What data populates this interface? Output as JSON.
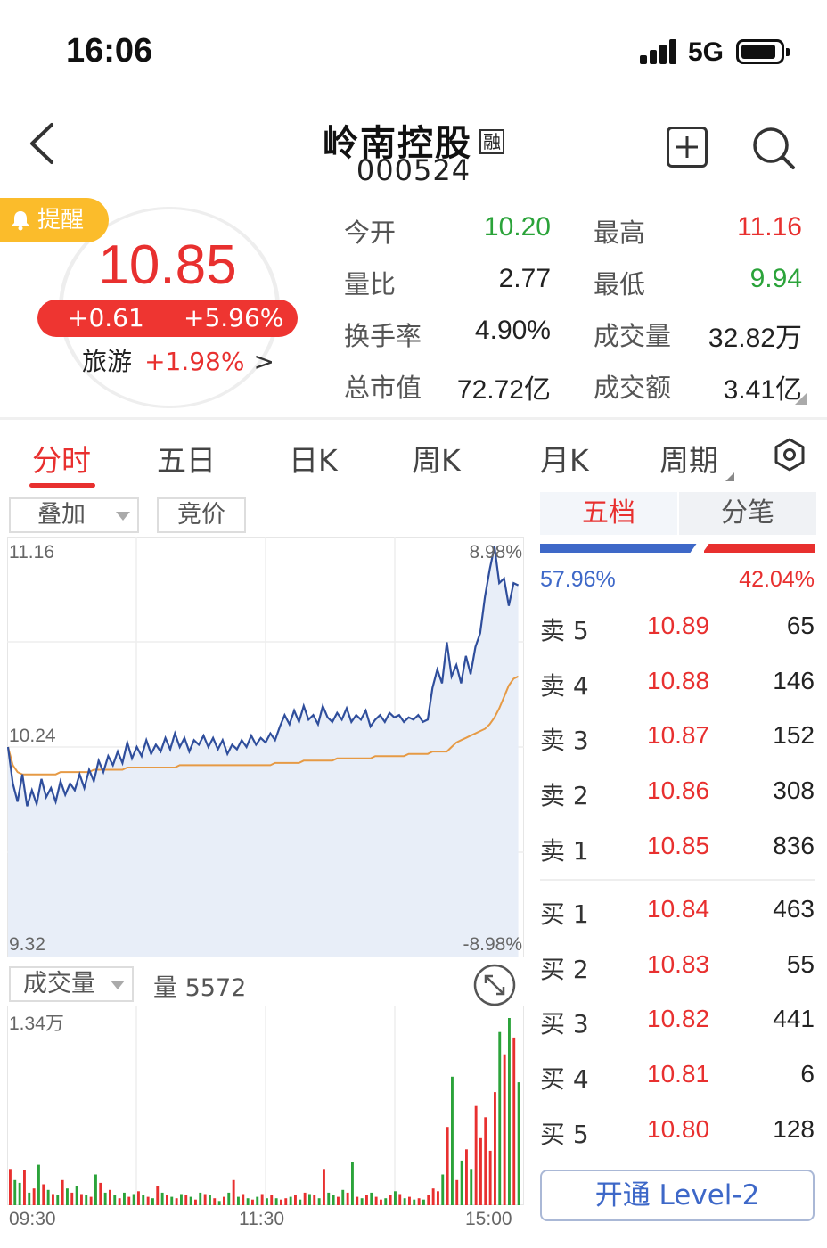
{
  "status_bar": {
    "time": "16:06",
    "network": "5G"
  },
  "header": {
    "name": "岭南控股",
    "badge": "融",
    "code": "000524"
  },
  "alert": {
    "label": "提醒"
  },
  "quote": {
    "price": "10.85",
    "change": "+0.61",
    "change_pct": "+5.96%",
    "sector_name": "旅游",
    "sector_pct": "+1.98%",
    "sector_arrow": ">"
  },
  "stats": [
    {
      "label": "今开",
      "value": "10.20",
      "color": "green"
    },
    {
      "label": "最高",
      "value": "11.16",
      "color": "red"
    },
    {
      "label": "量比",
      "value": "2.77",
      "color": "dark"
    },
    {
      "label": "最低",
      "value": "9.94",
      "color": "green"
    },
    {
      "label": "换手率",
      "value": "4.90%",
      "color": "dark"
    },
    {
      "label": "成交量",
      "value": "32.82万",
      "color": "dark"
    },
    {
      "label": "总市值",
      "value": "72.72亿",
      "color": "dark"
    },
    {
      "label": "成交额",
      "value": "3.41亿",
      "color": "dark"
    }
  ],
  "tabs": [
    "分时",
    "五日",
    "日K",
    "周K",
    "月K",
    "周期"
  ],
  "active_tab": "分时",
  "controls": {
    "overlay": "叠加",
    "auction": "竞价",
    "volume_select": "成交量",
    "volume_text": "量 5572"
  },
  "chart_data": {
    "type": "line",
    "title": "",
    "y_labels": {
      "top": "11.16",
      "mid": "10.24",
      "bottom": "9.32"
    },
    "pct_labels": {
      "top": "8.98%",
      "bottom": "-8.98%"
    },
    "ylim": [
      9.32,
      11.16
    ],
    "prev_close": 10.24,
    "series": [
      {
        "color": "#2f4e9c",
        "values": [
          10.24,
          10.08,
          10.0,
          10.12,
          9.98,
          10.05,
          9.99,
          10.1,
          10.02,
          10.06,
          10.0,
          10.09,
          10.03,
          10.08,
          10.05,
          10.12,
          10.06,
          10.14,
          10.09,
          10.18,
          10.13,
          10.2,
          10.16,
          10.22,
          10.17,
          10.26,
          10.19,
          10.24,
          10.2,
          10.27,
          10.21,
          10.25,
          10.22,
          10.28,
          10.23,
          10.3,
          10.24,
          10.28,
          10.22,
          10.27,
          10.25,
          10.29,
          10.24,
          10.28,
          10.23,
          10.27,
          10.21,
          10.25,
          10.23,
          10.27,
          10.24,
          10.29,
          10.25,
          10.28,
          10.26,
          10.3,
          10.27,
          10.33,
          10.38,
          10.34,
          10.4,
          10.35,
          10.42,
          10.36,
          10.38,
          10.34,
          10.42,
          10.37,
          10.35,
          10.39,
          10.36,
          10.41,
          10.35,
          10.38,
          10.36,
          10.4,
          10.33,
          10.36,
          10.38,
          10.35,
          10.39,
          10.37,
          10.38,
          10.35,
          10.37,
          10.36,
          10.38,
          10.35,
          10.36,
          10.5,
          10.58,
          10.52,
          10.7,
          10.55,
          10.6,
          10.52,
          10.64,
          10.56,
          10.68,
          10.74,
          10.9,
          11.02,
          11.12,
          10.96,
          10.98,
          10.86,
          10.96,
          10.95
        ]
      },
      {
        "color": "#e69a45",
        "values": [
          10.24,
          10.16,
          10.13,
          10.12,
          10.12,
          10.12,
          10.12,
          10.12,
          10.12,
          10.12,
          10.12,
          10.13,
          10.13,
          10.13,
          10.13,
          10.13,
          10.13,
          10.13,
          10.14,
          10.14,
          10.14,
          10.14,
          10.14,
          10.14,
          10.14,
          10.15,
          10.15,
          10.15,
          10.15,
          10.15,
          10.15,
          10.15,
          10.15,
          10.15,
          10.15,
          10.15,
          10.16,
          10.16,
          10.16,
          10.16,
          10.16,
          10.16,
          10.16,
          10.16,
          10.16,
          10.16,
          10.16,
          10.16,
          10.16,
          10.16,
          10.16,
          10.16,
          10.16,
          10.16,
          10.16,
          10.16,
          10.17,
          10.17,
          10.17,
          10.17,
          10.17,
          10.17,
          10.18,
          10.18,
          10.18,
          10.18,
          10.18,
          10.18,
          10.18,
          10.19,
          10.19,
          10.19,
          10.19,
          10.19,
          10.19,
          10.19,
          10.19,
          10.2,
          10.2,
          10.2,
          10.2,
          10.2,
          10.2,
          10.2,
          10.21,
          10.21,
          10.21,
          10.21,
          10.21,
          10.22,
          10.22,
          10.22,
          10.22,
          10.24,
          10.26,
          10.27,
          10.28,
          10.29,
          10.3,
          10.31,
          10.32,
          10.34,
          10.37,
          10.41,
          10.46,
          10.51,
          10.54,
          10.55
        ]
      }
    ],
    "volume": {
      "max_label": "1.34万",
      "max": 13400,
      "x_labels": [
        "09:30",
        "11:30",
        "15:00"
      ],
      "values": [
        2600,
        1800,
        1600,
        2500,
        900,
        1200,
        2900,
        1500,
        1100,
        800,
        700,
        1800,
        1200,
        900,
        1400,
        800,
        700,
        600,
        2200,
        1600,
        900,
        1100,
        700,
        500,
        900,
        600,
        800,
        1000,
        700,
        600,
        500,
        1400,
        900,
        700,
        600,
        500,
        800,
        700,
        600,
        400,
        900,
        800,
        700,
        500,
        300,
        600,
        900,
        1800,
        600,
        800,
        500,
        400,
        600,
        800,
        500,
        700,
        500,
        400,
        500,
        600,
        700,
        400,
        900,
        800,
        700,
        500,
        2600,
        900,
        700,
        600,
        1100,
        900,
        3100,
        600,
        500,
        700,
        900,
        600,
        400,
        500,
        700,
        1000,
        800,
        500,
        600,
        400,
        500,
        400,
        700,
        1200,
        1000,
        2200,
        5600,
        9200,
        1800,
        3200,
        4000,
        2600,
        7100,
        4800,
        6300,
        3900,
        8100,
        12400,
        10800,
        13400,
        12000,
        8800
      ]
    }
  },
  "orderbook": {
    "tab_on": "五档",
    "tab_off": "分笔",
    "buy_ratio": "57.96%",
    "sell_ratio": "42.04%",
    "asks": [
      {
        "label": "卖 5",
        "price": "10.89",
        "qty": "65"
      },
      {
        "label": "卖 4",
        "price": "10.88",
        "qty": "146"
      },
      {
        "label": "卖 3",
        "price": "10.87",
        "qty": "152"
      },
      {
        "label": "卖 2",
        "price": "10.86",
        "qty": "308"
      },
      {
        "label": "卖 1",
        "price": "10.85",
        "qty": "836"
      }
    ],
    "bids": [
      {
        "label": "买 1",
        "price": "10.84",
        "qty": "463"
      },
      {
        "label": "买 2",
        "price": "10.83",
        "qty": "55"
      },
      {
        "label": "买 3",
        "price": "10.82",
        "qty": "441"
      },
      {
        "label": "买 4",
        "price": "10.81",
        "qty": "6"
      },
      {
        "label": "买 5",
        "price": "10.80",
        "qty": "128"
      }
    ],
    "level2_btn": "开通 Level-2"
  }
}
